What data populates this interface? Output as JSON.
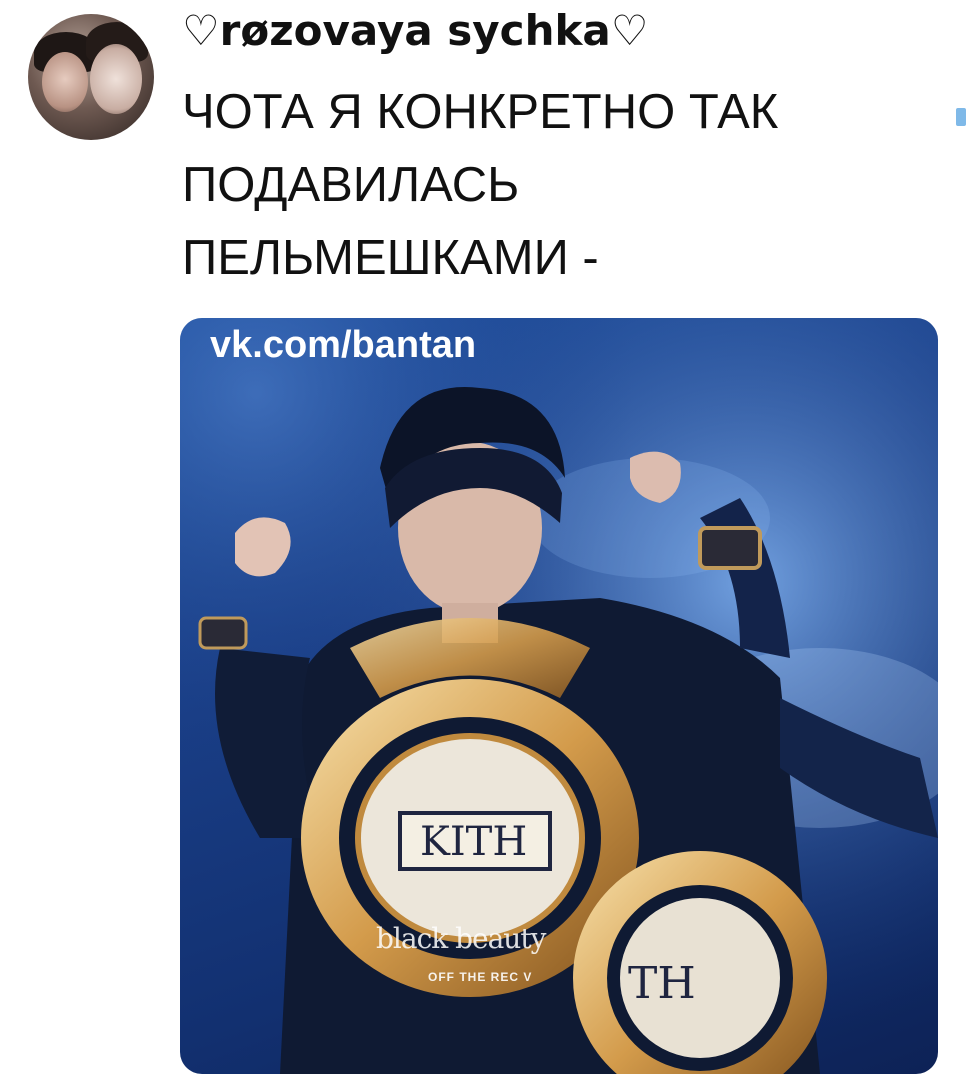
{
  "tweet": {
    "username": "♡røzovaya sychka♡",
    "text_lines": [
      "ЧОТА Я КОНКРЕТНО ТАК",
      "ПОДАВИЛАСЬ",
      "ПЕЛЬМЕШКАМИ -"
    ]
  },
  "media": {
    "watermark": "vk.com/bantan",
    "caption_script": "black beauty",
    "caption_small": "OFF THE REC V",
    "shirt_logo": "KITH",
    "shirt_logo_partial": "TH"
  },
  "colors": {
    "text": "#111111",
    "media_bg": "#1a3f88",
    "accent_blue": "#7fb9e8"
  }
}
